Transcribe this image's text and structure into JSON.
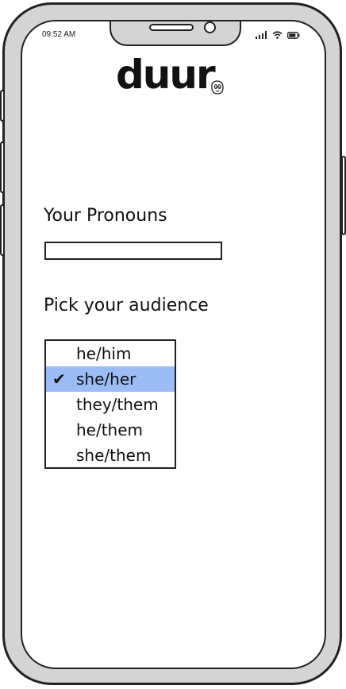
{
  "status_bar": {
    "time": "09:52 AM",
    "icons": [
      "signal-icon",
      "wifi-icon",
      "battery-icon"
    ]
  },
  "app": {
    "logo_text": "duur"
  },
  "pronouns": {
    "label": "Your Pronouns",
    "value": "",
    "placeholder": ""
  },
  "audience": {
    "label": "Pick your audience",
    "options": [
      "he/him",
      "she/her",
      "they/them",
      "he/them",
      "she/them"
    ],
    "selected": "she/her",
    "selected_color": "#9cbcf5"
  }
}
